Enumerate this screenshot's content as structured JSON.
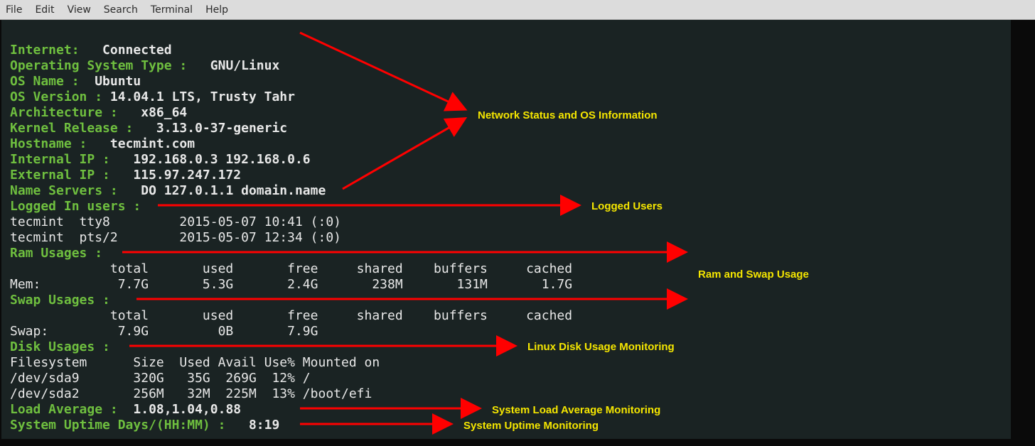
{
  "menu": {
    "file": "File",
    "edit": "Edit",
    "view": "View",
    "search": "Search",
    "terminal": "Terminal",
    "help": "Help"
  },
  "sys": {
    "internet_label": "Internet: ",
    "internet_value": "  Connected",
    "ostype_label": "Operating System Type : ",
    "ostype_value": "  GNU/Linux",
    "osname_label": "OS Name : ",
    "osname_value": " Ubuntu",
    "osver_label": "OS Version : ",
    "osver_value": "14.04.1 LTS, Trusty Tahr",
    "arch_label": "Architecture : ",
    "arch_value": "  x86_64",
    "kernel_label": "Kernel Release : ",
    "kernel_value": "  3.13.0-37-generic",
    "host_label": "Hostname : ",
    "host_value": "  tecmint.com",
    "intip_label": "Internal IP : ",
    "intip_value": "  192.168.0.3 192.168.0.6",
    "extip_label": "External IP : ",
    "extip_value": "  115.97.247.172",
    "ns_label": "Name Servers : ",
    "ns_value": "  DO 127.0.1.1 domain.name",
    "logged_label": "Logged In users : ",
    "user1": "tecmint  tty8         2015-05-07 10:41 (:0)",
    "user2": "tecmint  pts/2        2015-05-07 12:34 (:0)",
    "ram_label": "Ram Usages : ",
    "ram_hdr": "             total       used       free     shared    buffers     cached",
    "ram_row": "Mem:          7.7G       5.3G       2.4G       238M       131M       1.7G",
    "swap_label": "Swap Usages : ",
    "swap_hdr": "             total       used       free     shared    buffers     cached",
    "swap_row": "Swap:         7.9G         0B       7.9G",
    "disk_label": "Disk Usages : ",
    "disk_hdr": "Filesystem      Size  Used Avail Use% Mounted on",
    "disk_r1": "/dev/sda9       320G   35G  269G  12% /",
    "disk_r2": "/dev/sda2       256M   32M  225M  13% /boot/efi",
    "load_label": "Load Average : ",
    "load_value": " 1.08,1.04,0.88",
    "uptime_label": "System Uptime Days/(HH:MM) : ",
    "uptime_value": "  8:19"
  },
  "ann": {
    "net": "Network Status and OS Information",
    "log": "Logged Users",
    "ram": "Ram and Swap Usage",
    "disk": "Linux Disk Usage Monitoring",
    "load": "System Load Average Monitoring",
    "up": "System Uptime Monitoring"
  }
}
